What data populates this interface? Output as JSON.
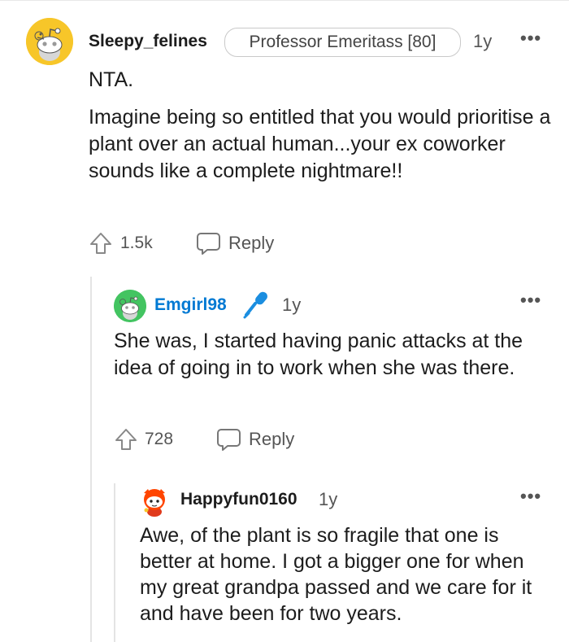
{
  "comments": [
    {
      "author": "Sleepy_felines",
      "flair": "Professor Emeritass [80]",
      "age": "1y",
      "more": "•••",
      "body_title": "NTA.",
      "body": "Imagine being so entitled that you would prioritise a plant over an actual human...your ex coworker sounds like a complete nightmare!!",
      "votes": "1.5k",
      "reply_label": "Reply",
      "avatar_icon": "snoo-avatar-icon",
      "avatar_color": "#f7c629"
    },
    {
      "author": "Emgirl98",
      "flair_icon": "microphone-icon",
      "age": "1y",
      "more": "•••",
      "body": "She was, I started having panic attacks at the idea of going in to work when she was there.",
      "votes": "728",
      "reply_label": "Reply",
      "avatar_icon": "snoo-avatar-icon",
      "avatar_color": "#43c461",
      "author_color": "#0079d3"
    },
    {
      "author": "Happyfun0160",
      "age": "1y",
      "more": "•••",
      "body": "Awe, of the plant is so fragile that one is better at home. I got a bigger one for when my great grandpa passed and we care for it and have been for two years.",
      "avatar_icon": "snoo-avatar-icon",
      "avatar_color": "#ff4500"
    }
  ],
  "icons": {
    "upvote": "upvote-arrow-icon",
    "reply": "speech-bubble-icon"
  }
}
